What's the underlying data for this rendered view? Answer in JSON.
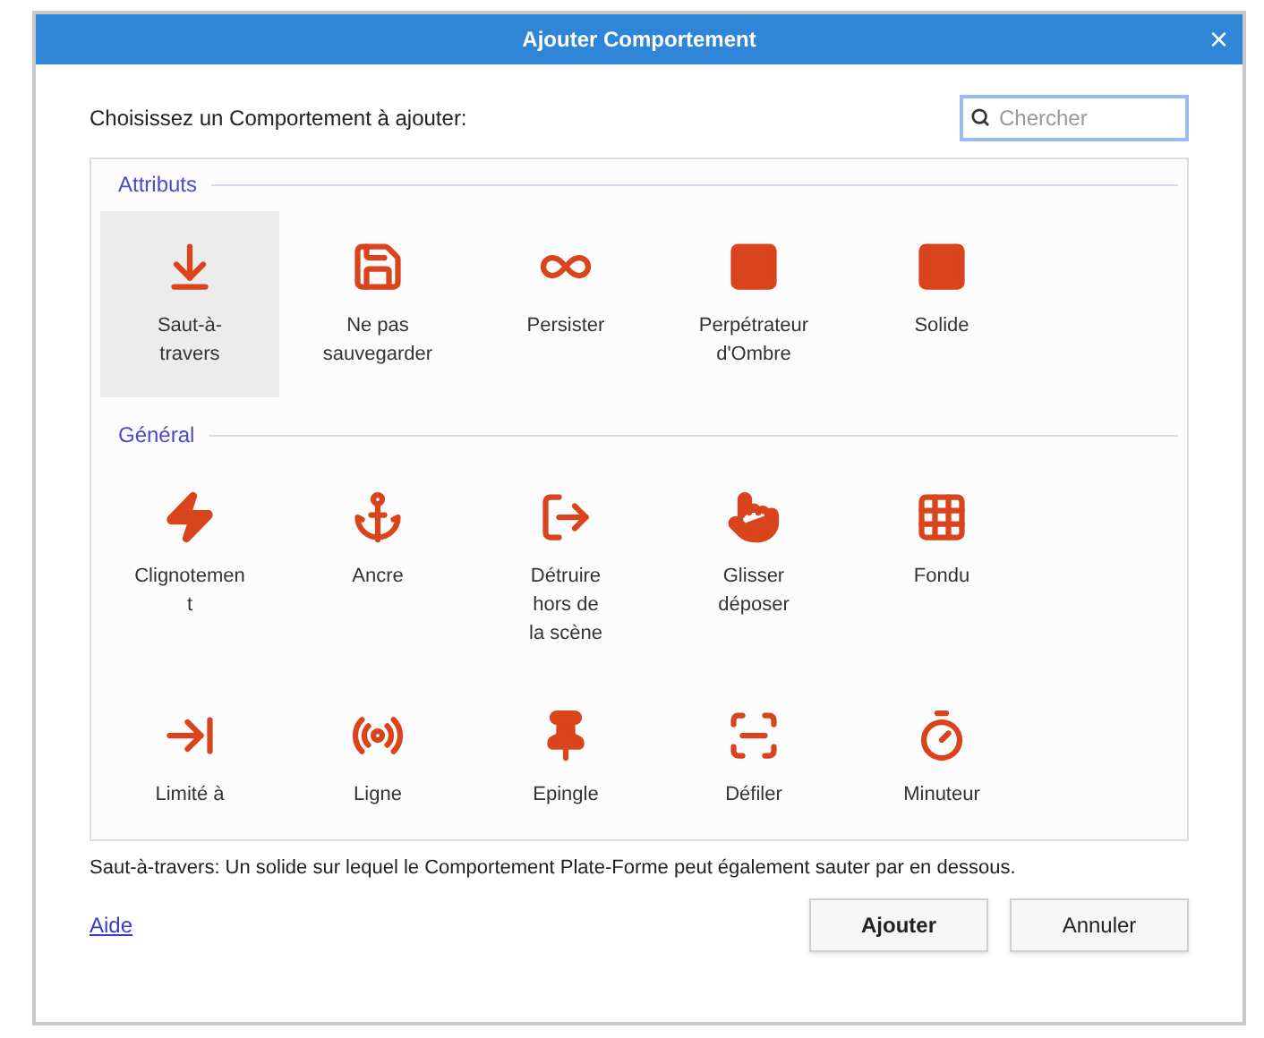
{
  "window": {
    "title": "Ajouter Comportement",
    "close": "×"
  },
  "prompt": "Choisissez un Comportement à ajouter:",
  "search": {
    "placeholder": "Chercher"
  },
  "groups": [
    {
      "title": "Attributs",
      "items": [
        {
          "label": "Saut-à-\ntravers",
          "selected": true
        },
        {
          "label": "Ne pas\nsauvegarder",
          "selected": false
        },
        {
          "label": "Persister",
          "selected": false
        },
        {
          "label": "Perpétrateur\nd'Ombre",
          "selected": false
        },
        {
          "label": "Solide",
          "selected": false
        }
      ]
    },
    {
      "title": "Général",
      "items": [
        {
          "label": "Clignotemen\nt",
          "selected": false
        },
        {
          "label": "Ancre",
          "selected": false
        },
        {
          "label": "Détruire\nhors de\nla scène",
          "selected": false
        },
        {
          "label": "Glisser\ndéposer",
          "selected": false
        },
        {
          "label": "Fondu",
          "selected": false
        },
        {
          "label": "Limité à",
          "selected": false
        },
        {
          "label": "Ligne",
          "selected": false
        },
        {
          "label": "Epingle",
          "selected": false
        },
        {
          "label": "Défiler",
          "selected": false
        },
        {
          "label": "Minuteur",
          "selected": false
        }
      ]
    }
  ],
  "description": "Saut-à-travers: Un solide sur lequel le Comportement Plate-Forme peut également sauter par en dessous.",
  "help_link": "Aide",
  "buttons": [
    "Ajouter",
    "Annuler"
  ]
}
